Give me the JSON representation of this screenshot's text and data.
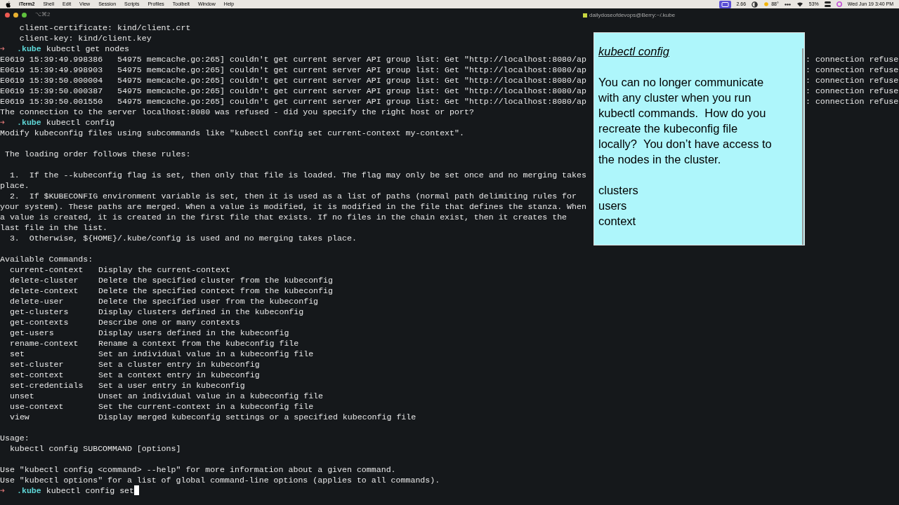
{
  "menu_bar": {
    "app": "iTerm2",
    "items": [
      "Shell",
      "Edit",
      "View",
      "Session",
      "Scripts",
      "Profiles",
      "Toolbelt",
      "Window",
      "Help"
    ],
    "status": {
      "load": "2.66",
      "weather": "88°",
      "battery": "53%",
      "clock": "Wed Jun 19  3:40 PM"
    }
  },
  "window": {
    "shortcut": "⌥⌘2",
    "title": "dailydoseofdevops@Berry:~/.kube"
  },
  "terminal": {
    "lines": [
      {
        "kind": "text",
        "text": "    client-certificate: kind/client.crt"
      },
      {
        "kind": "text",
        "text": "    client-key: kind/client.key"
      },
      {
        "kind": "prompt",
        "symbol": "➜",
        "dir": ".kube",
        "command": "kubectl get nodes"
      },
      {
        "kind": "split",
        "left": "E0619 15:39:49.998386   54975 memcache.go:265] couldn't get current server API group list: Get \"http://localhost:8080/ap",
        "right": ": connection refuse"
      },
      {
        "kind": "split",
        "left": "E0619 15:39:49.998903   54975 memcache.go:265] couldn't get current server API group list: Get \"http://localhost:8080/ap",
        "right": ": connection refuse"
      },
      {
        "kind": "split",
        "left": "E0619 15:39:50.000004   54975 memcache.go:265] couldn't get current server API group list: Get \"http://localhost:8080/ap",
        "right": ": connection refuse"
      },
      {
        "kind": "split",
        "left": "E0619 15:39:50.000387   54975 memcache.go:265] couldn't get current server API group list: Get \"http://localhost:8080/ap",
        "right": ": connection refuse"
      },
      {
        "kind": "split",
        "left": "E0619 15:39:50.001550   54975 memcache.go:265] couldn't get current server API group list: Get \"http://localhost:8080/ap",
        "right": ": connection refuse"
      },
      {
        "kind": "text",
        "text": "The connection to the server localhost:8080 was refused - did you specify the right host or port?"
      },
      {
        "kind": "prompt",
        "symbol": "➜",
        "dir": ".kube",
        "command": "kubectl config"
      },
      {
        "kind": "text",
        "text": "Modify kubeconfig files using subcommands like \"kubectl config set current-context my-context\"."
      },
      {
        "kind": "blank"
      },
      {
        "kind": "text",
        "text": " The loading order follows these rules:"
      },
      {
        "kind": "blank"
      },
      {
        "kind": "text",
        "text": "  1.  If the --kubeconfig flag is set, then only that file is loaded. The flag may only be set once and no merging takes"
      },
      {
        "kind": "text",
        "text": "place."
      },
      {
        "kind": "text",
        "text": "  2.  If $KUBECONFIG environment variable is set, then it is used as a list of paths (normal path delimiting rules for"
      },
      {
        "kind": "text",
        "text": "your system). These paths are merged. When a value is modified, it is modified in the file that defines the stanza. When"
      },
      {
        "kind": "text",
        "text": "a value is created, it is created in the first file that exists. If no files in the chain exist, then it creates the"
      },
      {
        "kind": "text",
        "text": "last file in the list."
      },
      {
        "kind": "text",
        "text": "  3.  Otherwise, ${HOME}/.kube/config is used and no merging takes place."
      },
      {
        "kind": "blank"
      },
      {
        "kind": "text",
        "text": "Available Commands:"
      },
      {
        "kind": "cmd",
        "name": "current-context",
        "desc": "Display the current-context"
      },
      {
        "kind": "cmd",
        "name": "delete-cluster",
        "desc": "Delete the specified cluster from the kubeconfig"
      },
      {
        "kind": "cmd",
        "name": "delete-context",
        "desc": "Delete the specified context from the kubeconfig"
      },
      {
        "kind": "cmd",
        "name": "delete-user",
        "desc": "Delete the specified user from the kubeconfig"
      },
      {
        "kind": "cmd",
        "name": "get-clusters",
        "desc": "Display clusters defined in the kubeconfig"
      },
      {
        "kind": "cmd",
        "name": "get-contexts",
        "desc": "Describe one or many contexts"
      },
      {
        "kind": "cmd",
        "name": "get-users",
        "desc": "Display users defined in the kubeconfig"
      },
      {
        "kind": "cmd",
        "name": "rename-context",
        "desc": "Rename a context from the kubeconfig file"
      },
      {
        "kind": "cmd",
        "name": "set",
        "desc": "Set an individual value in a kubeconfig file"
      },
      {
        "kind": "cmd",
        "name": "set-cluster",
        "desc": "Set a cluster entry in kubeconfig"
      },
      {
        "kind": "cmd",
        "name": "set-context",
        "desc": "Set a context entry in kubeconfig"
      },
      {
        "kind": "cmd",
        "name": "set-credentials",
        "desc": "Set a user entry in kubeconfig"
      },
      {
        "kind": "cmd",
        "name": "unset",
        "desc": "Unset an individual value in a kubeconfig file"
      },
      {
        "kind": "cmd",
        "name": "use-context",
        "desc": "Set the current-context in a kubeconfig file"
      },
      {
        "kind": "cmd",
        "name": "view",
        "desc": "Display merged kubeconfig settings or a specified kubeconfig file"
      },
      {
        "kind": "blank"
      },
      {
        "kind": "text",
        "text": "Usage:"
      },
      {
        "kind": "text",
        "text": "  kubectl config SUBCOMMAND [options]"
      },
      {
        "kind": "blank"
      },
      {
        "kind": "text",
        "text": "Use \"kubectl config <command> --help\" for more information about a given command."
      },
      {
        "kind": "text",
        "text": "Use \"kubectl options\" for a list of global command-line options (applies to all commands)."
      },
      {
        "kind": "prompt",
        "symbol": "➜",
        "dir": ".kube",
        "command": "kubectl config set",
        "cursor": true
      }
    ]
  },
  "note": {
    "title": "kubectl config",
    "paragraph_lines": [
      "You can no longer communicate",
      "with any cluster when you run",
      "kubectl commands.  How do you",
      "recreate the kubeconfig file",
      "locally?  You don’t have access to",
      "the nodes in the cluster."
    ],
    "items": [
      "clusters",
      "users",
      "context"
    ]
  }
}
